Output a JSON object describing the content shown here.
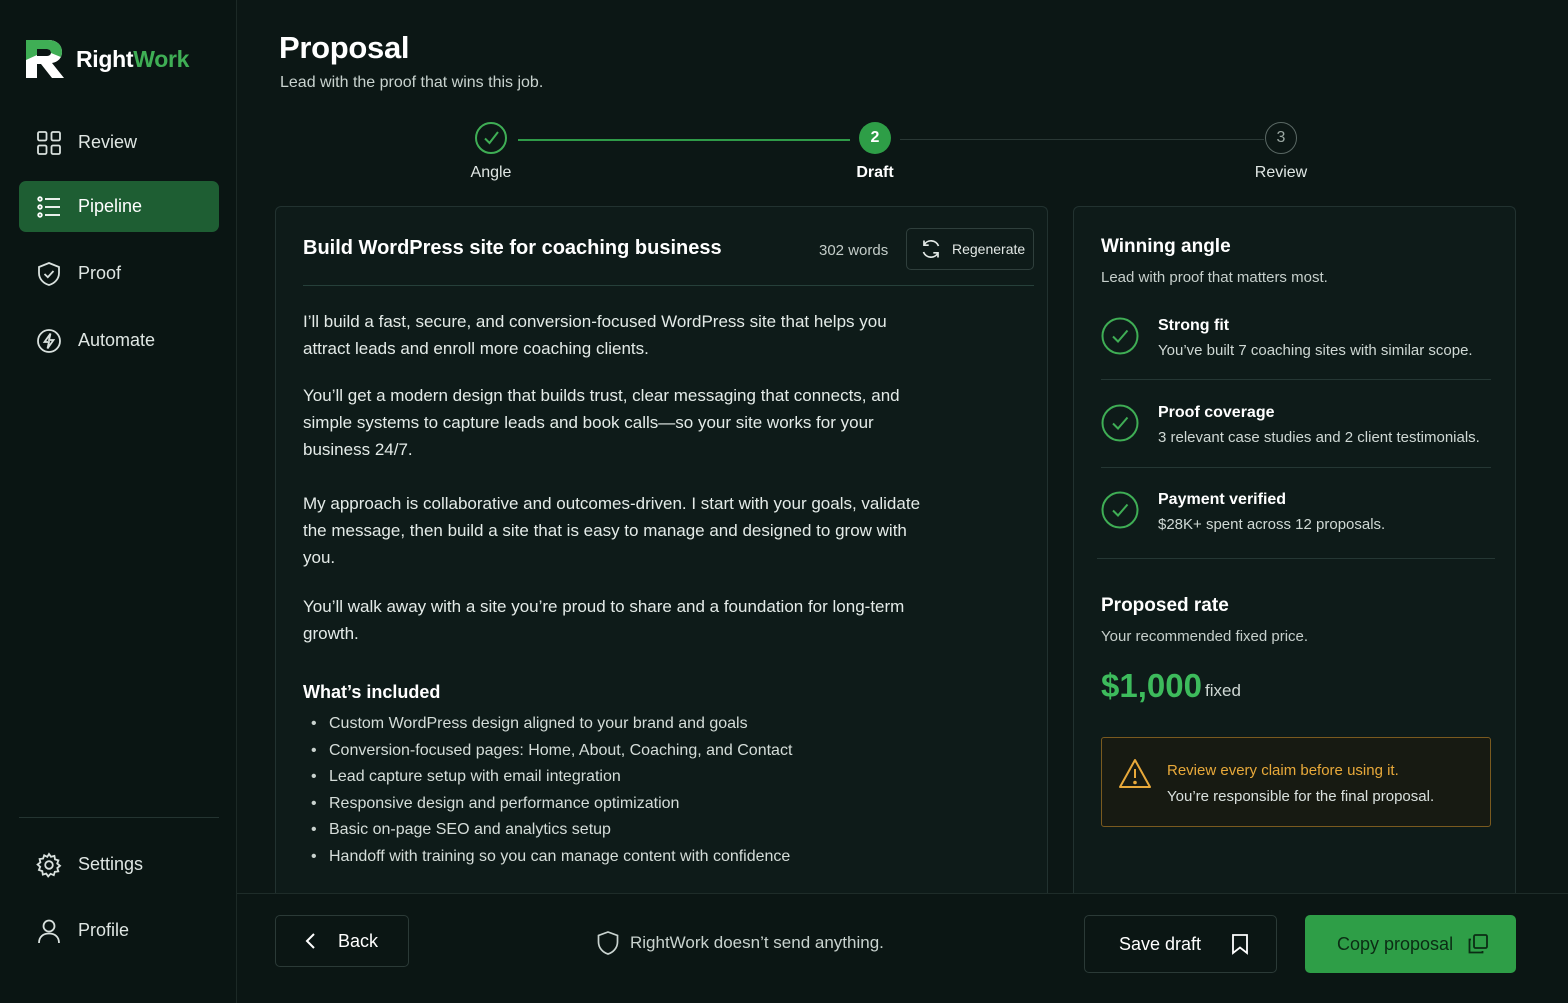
{
  "brand": {
    "name_part1": "Right",
    "name_part2": "Work",
    "accent": "#3fae55"
  },
  "nav": {
    "items": [
      {
        "label": "Review",
        "icon": "grid-icon"
      },
      {
        "label": "Pipeline",
        "icon": "list-icon",
        "active": true
      },
      {
        "label": "Proof",
        "icon": "shield-check-icon"
      },
      {
        "label": "Automate",
        "icon": "bolt-icon"
      }
    ],
    "bottom": [
      {
        "label": "Settings",
        "icon": "gear-icon"
      },
      {
        "label": "Profile",
        "icon": "user-icon"
      }
    ]
  },
  "page": {
    "title": "Proposal",
    "subtitle": "Lead with the proof that wins this job."
  },
  "stepper": {
    "steps": [
      {
        "number": "1",
        "label": "Angle",
        "state": "done"
      },
      {
        "number": "2",
        "label": "Draft",
        "state": "current"
      },
      {
        "number": "3",
        "label": "Review",
        "state": "upcoming"
      }
    ]
  },
  "draft": {
    "title": "Build WordPress site for coaching business",
    "word_count": "302 words",
    "regenerate_label": "Regenerate",
    "paragraphs": [
      "I’ll build a fast, secure, and conversion-focused WordPress site that helps you attract leads and enroll more coaching clients.",
      "You’ll get a modern design that builds trust, clear messaging that connects, and simple systems to capture leads and book calls—so your site works for your business 24/7.",
      "My approach is collaborative and outcomes-driven. I start with your goals, validate the message, then build a site that is easy to manage and designed to grow with you.",
      "You’ll walk away with a site you’re proud to share and a foundation for long-term growth."
    ],
    "included_title": "What’s included",
    "included": [
      "Custom WordPress design aligned to your brand and goals",
      "Conversion-focused pages: Home, About, Coaching, and Contact",
      "Lead capture setup with email integration",
      "Responsive design and performance optimization",
      "Basic on-page SEO and analytics setup",
      "Handoff with training so you can manage content with confidence"
    ]
  },
  "angle": {
    "title": "Winning angle",
    "subtitle": "Lead with proof that matters most.",
    "items": [
      {
        "title": "Strong fit",
        "detail": "You’ve built 7 coaching sites with similar scope."
      },
      {
        "title": "Proof coverage",
        "detail": "3 relevant case studies and 2 client testimonials."
      },
      {
        "title": "Payment verified",
        "detail": "$28K+ spent across 12 proposals."
      }
    ]
  },
  "rate": {
    "title": "Proposed rate",
    "subtitle": "Your recommended fixed price.",
    "amount": "$1,000",
    "unit": "fixed"
  },
  "warning": {
    "line1": "Review every claim before using it.",
    "line2": "You’re responsible for the final proposal."
  },
  "footer": {
    "back_label": "Back",
    "note": "RightWork doesn’t send anything.",
    "save_label": "Save draft",
    "copy_label": "Copy proposal"
  }
}
